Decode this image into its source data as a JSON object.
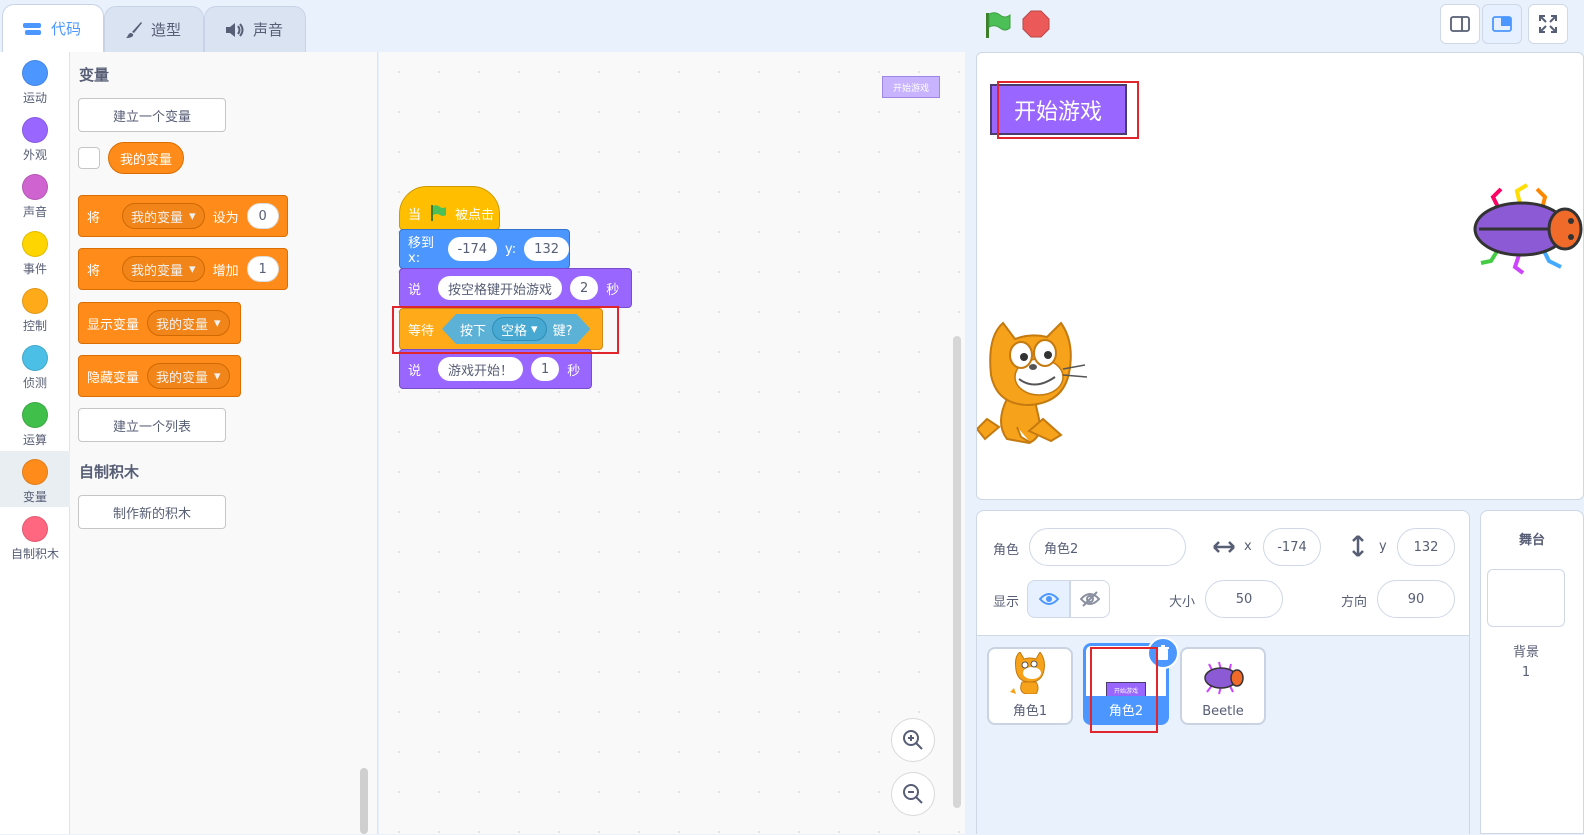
{
  "tabs": {
    "code": "代码",
    "costume": "造型",
    "sound": "声音"
  },
  "categories": [
    {
      "label": "运动",
      "color": "#4c97ff"
    },
    {
      "label": "外观",
      "color": "#9966ff"
    },
    {
      "label": "声音",
      "color": "#cf63cf"
    },
    {
      "label": "事件",
      "color": "#ffd500"
    },
    {
      "label": "控制",
      "color": "#ffab19"
    },
    {
      "label": "侦测",
      "color": "#4cbfe6"
    },
    {
      "label": "运算",
      "color": "#40bf4a"
    },
    {
      "label": "变量",
      "color": "#ff8c1a"
    },
    {
      "label": "自制积木",
      "color": "#ff6680"
    }
  ],
  "palette": {
    "variables_title": "变量",
    "make_variable": "建立一个变量",
    "my_variable": "我的变量",
    "set_block": {
      "prefix": "将",
      "var": "我的变量",
      "op": "设为",
      "value": "0"
    },
    "change_block": {
      "prefix": "将",
      "var": "我的变量",
      "op": "增加",
      "value": "1"
    },
    "show_block": {
      "op": "显示变量",
      "var": "我的变量"
    },
    "hide_block": {
      "op": "隐藏变量",
      "var": "我的变量"
    },
    "make_list": "建立一个列表",
    "my_blocks_title": "自制积木",
    "make_block": "制作新的积木"
  },
  "script": {
    "hat": {
      "when": "当",
      "clicked": "被点击"
    },
    "goto": {
      "label": "移到 x:",
      "x": "-174",
      "ylabel": "y:",
      "y": "132"
    },
    "say1": {
      "label": "说",
      "text": "按空格键开始游戏",
      "secs": "2",
      "unit": "秒"
    },
    "wait": {
      "label": "等待",
      "key_label": "按下",
      "key": "空格",
      "suffix": "键?"
    },
    "say2": {
      "label": "说",
      "text": "游戏开始！",
      "secs": "1",
      "unit": "秒"
    }
  },
  "workspace_thumb": "开始游戏",
  "stage": {
    "button_text": "开始游戏"
  },
  "sprite_info": {
    "sprite_label": "角色",
    "sprite_name": "角色2",
    "x_label": "x",
    "x": "-174",
    "y_label": "y",
    "y": "132",
    "show_label": "显示",
    "size_label": "大小",
    "size": "50",
    "direction_label": "方向",
    "direction": "90"
  },
  "sprites": [
    {
      "name": "角色1"
    },
    {
      "name": "角色2",
      "thumb_text": "开始游戏"
    },
    {
      "name": "Beetle"
    }
  ],
  "backdrop": {
    "title": "舞台",
    "label": "背景",
    "count": "1"
  },
  "colors": {
    "accent": "#4c97ff",
    "looks": "#9966ff",
    "events": "#ffbf00",
    "motion": "#4c97ff",
    "variables": "#ff8c1a",
    "sensing": "#5cb1d6",
    "highlight": "#e0262c"
  }
}
